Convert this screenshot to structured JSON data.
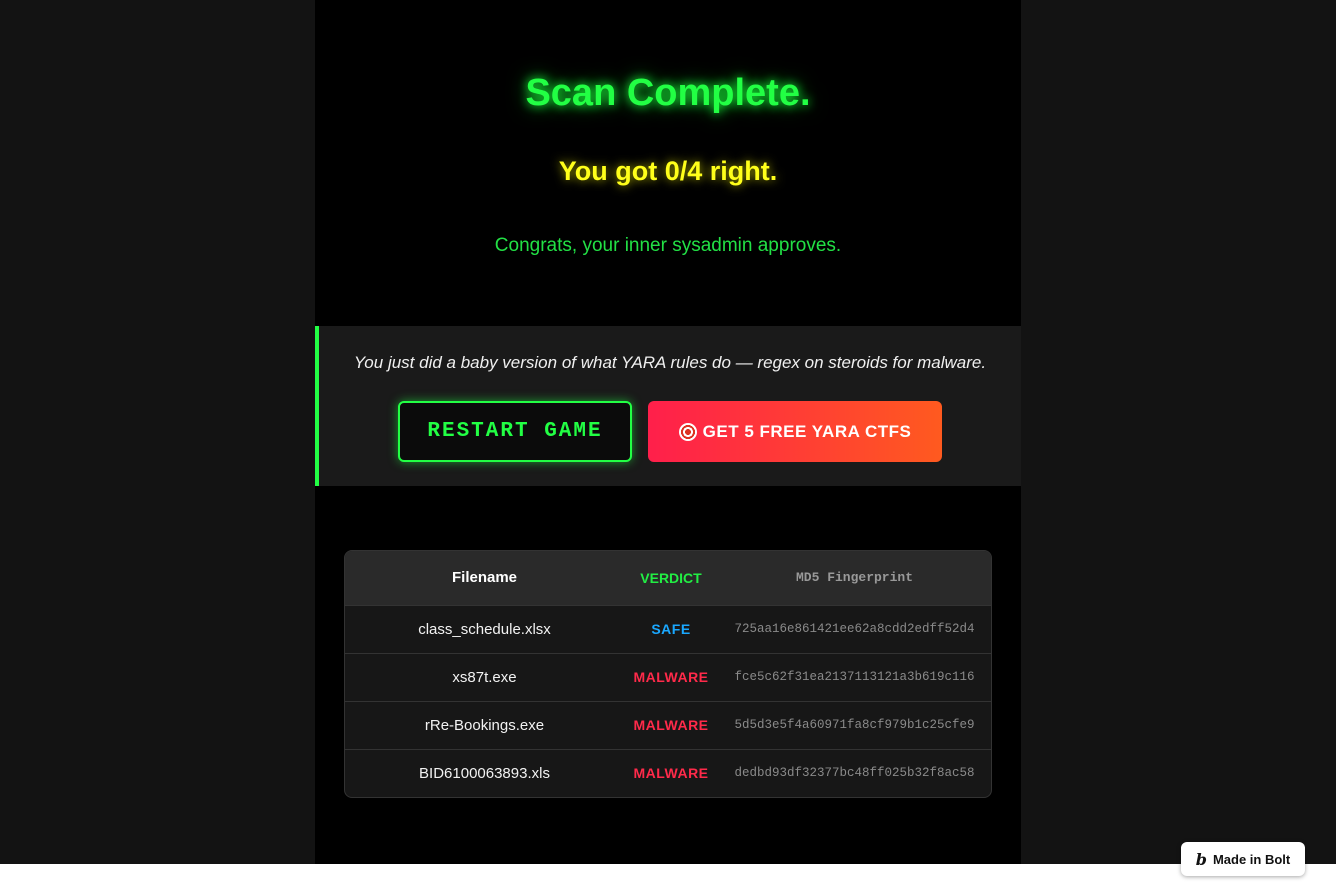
{
  "result": {
    "title": "Scan Complete.",
    "score": "You got 0/4 right.",
    "message": "Congrats, your inner sysadmin approves."
  },
  "panel": {
    "text": "You just did a baby version of what YARA rules do — regex on steroids for malware.",
    "restart_label": "RESTART GAME",
    "ctf_label": "GET 5 FREE YARA CTFS",
    "ctf_icon": "target-icon",
    "accent": "#22ff44"
  },
  "table": {
    "headers": [
      "Filename",
      "VERDICT",
      "MD5 Fingerprint"
    ],
    "rows": [
      {
        "filename": "class_schedule.xlsx",
        "verdict": "SAFE",
        "md5": "725aa16e861421ee62a8cdd2edff52d4"
      },
      {
        "filename": "xs87t.exe",
        "verdict": "MALWARE",
        "md5": "fce5c62f31ea2137113121a3b619c116"
      },
      {
        "filename": "rRe-Bookings.exe",
        "verdict": "MALWARE",
        "md5": "5d5d3e5f4a60971fa8cf979b1c25cfe9"
      },
      {
        "filename": "BID6100063893.xls",
        "verdict": "MALWARE",
        "md5": "dedbd93df32377bc48ff025b32f8ac58"
      }
    ],
    "colors": {
      "safe": "#1aa8ff",
      "malware": "#ff2a4a"
    }
  },
  "badge": {
    "label": "Made in Bolt",
    "icon": "bolt-icon"
  }
}
